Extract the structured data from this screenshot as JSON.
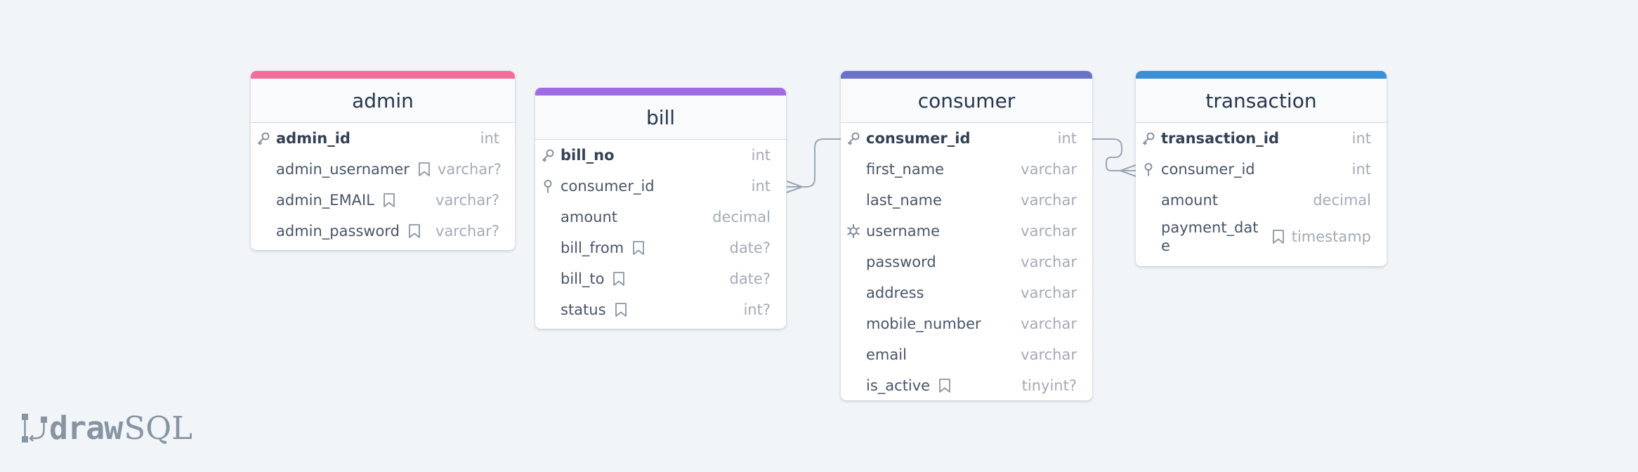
{
  "app": {
    "brand_prefix": "draw",
    "brand_suffix": "SQL"
  },
  "tables": [
    {
      "id": "admin",
      "name": "admin",
      "accent": "#f06e98",
      "columns": [
        {
          "name": "admin_id",
          "type": "int",
          "role": "primary-key",
          "note": false
        },
        {
          "name": "admin_usernamer",
          "type": "varchar?",
          "role": "",
          "note": true
        },
        {
          "name": "admin_EMAIL",
          "type": "varchar?",
          "role": "",
          "note": true
        },
        {
          "name": "admin_password",
          "type": "varchar?",
          "role": "",
          "note": true
        }
      ]
    },
    {
      "id": "bill",
      "name": "bill",
      "accent": "#9f6be3",
      "columns": [
        {
          "name": "bill_no",
          "type": "int",
          "role": "primary-key",
          "note": false
        },
        {
          "name": "consumer_id",
          "type": "int",
          "role": "foreign-key",
          "note": false
        },
        {
          "name": "amount",
          "type": "decimal",
          "role": "",
          "note": false
        },
        {
          "name": "bill_from",
          "type": "date?",
          "role": "",
          "note": true
        },
        {
          "name": "bill_to",
          "type": "date?",
          "role": "",
          "note": true
        },
        {
          "name": "status",
          "type": "int?",
          "role": "",
          "note": true
        }
      ]
    },
    {
      "id": "consumer",
      "name": "consumer",
      "accent": "#6a72c8",
      "columns": [
        {
          "name": "consumer_id",
          "type": "int",
          "role": "primary-key",
          "note": false
        },
        {
          "name": "first_name",
          "type": "varchar",
          "role": "",
          "note": false
        },
        {
          "name": "last_name",
          "type": "varchar",
          "role": "",
          "note": false
        },
        {
          "name": "username",
          "type": "varchar",
          "role": "unique",
          "note": false
        },
        {
          "name": "password",
          "type": "varchar",
          "role": "",
          "note": false
        },
        {
          "name": "address",
          "type": "varchar",
          "role": "",
          "note": false
        },
        {
          "name": "mobile_number",
          "type": "varchar",
          "role": "",
          "note": false
        },
        {
          "name": "email",
          "type": "varchar",
          "role": "",
          "note": false
        },
        {
          "name": "is_active",
          "type": "tinyint?",
          "role": "",
          "note": true
        }
      ]
    },
    {
      "id": "transaction",
      "name": "transaction",
      "accent": "#3a8fd6",
      "columns": [
        {
          "name": "transaction_id",
          "type": "int",
          "role": "primary-key",
          "note": false
        },
        {
          "name": "consumer_id",
          "type": "int",
          "role": "foreign-key",
          "note": false
        },
        {
          "name": "amount",
          "type": "decimal",
          "role": "",
          "note": false
        },
        {
          "name": "payment_date",
          "type": "timestamp",
          "role": "",
          "note": true
        }
      ]
    }
  ],
  "relations": [
    {
      "from": "consumer.consumer_id",
      "to": "bill.consumer_id",
      "cardinality": "one-to-many"
    },
    {
      "from": "consumer.consumer_id",
      "to": "transaction.consumer_id",
      "cardinality": "one-to-many"
    }
  ],
  "colors": {
    "connector": "#9aa6b4",
    "icon": "#7e8a99"
  }
}
